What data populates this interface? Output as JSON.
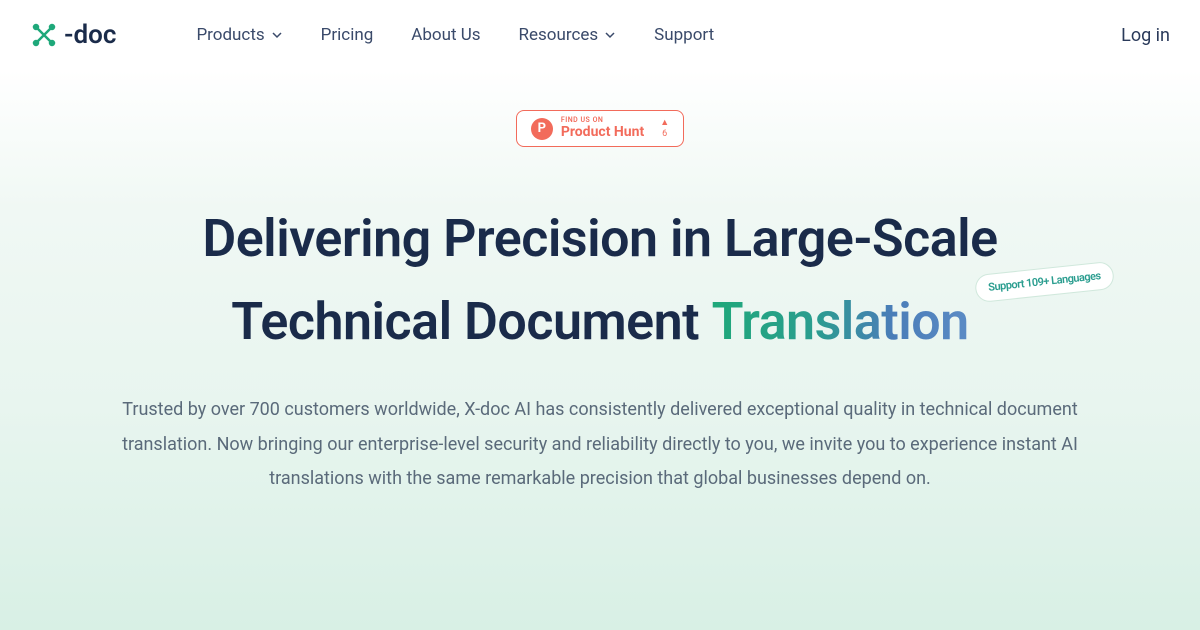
{
  "header": {
    "logo_text": "-doc",
    "nav": {
      "products": "Products",
      "pricing": "Pricing",
      "about": "About Us",
      "resources": "Resources",
      "support": "Support"
    },
    "login": "Log in"
  },
  "hero": {
    "ph_find": "FIND US ON",
    "ph_name": "Product Hunt",
    "ph_count": "6",
    "headline_line1": "Delivering Precision in Large-Scale",
    "headline_line2_prefix": "Technical Document ",
    "headline_highlight": "Translation",
    "lang_badge": "Support 109+ Languages",
    "subtitle": "Trusted by over 700 customers worldwide, X-doc AI has consistently delivered exceptional quality in technical document translation. Now bringing our enterprise-level security and reliability directly to you, we invite you to experience instant AI translations with the same remarkable precision that global businesses depend on."
  }
}
